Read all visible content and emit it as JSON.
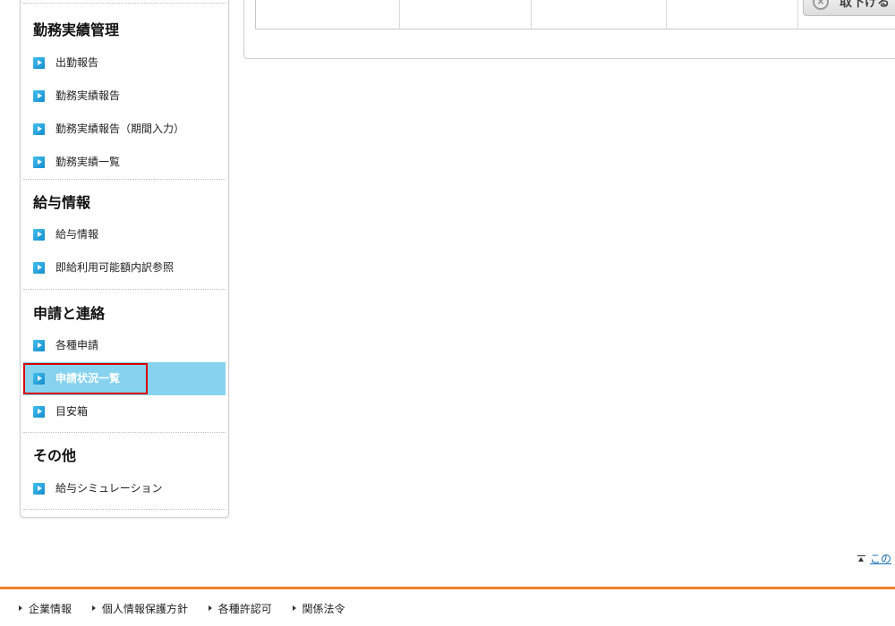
{
  "sidebar": {
    "sections": [
      {
        "title": "勤務実績管理",
        "items": [
          "出勤報告",
          "勤務実績報告",
          "勤務実績報告（期間入力）",
          "勤務実績一覧"
        ]
      },
      {
        "title": "給与情報",
        "items": [
          "給与情報",
          "即給利用可能額内訳参照"
        ]
      },
      {
        "title": "申請と連絡",
        "items": [
          "各種申請",
          "申請状況一覧",
          "目安箱"
        ]
      },
      {
        "title": "その他",
        "items": [
          "給与シミュレーション"
        ]
      }
    ],
    "active_item": "申請状況一覧"
  },
  "main": {
    "withdraw_button": "取下げる"
  },
  "pagetop": {
    "label": "この"
  },
  "footer": {
    "links": [
      "企業情報",
      "個人情報保護方針",
      "各種許認可",
      "関係法令"
    ]
  },
  "colors": {
    "accent_orange": "#ef8126",
    "active_bg": "#87d3ef",
    "highlight_red": "#d60000",
    "arrow_blue": "#168ccc"
  }
}
